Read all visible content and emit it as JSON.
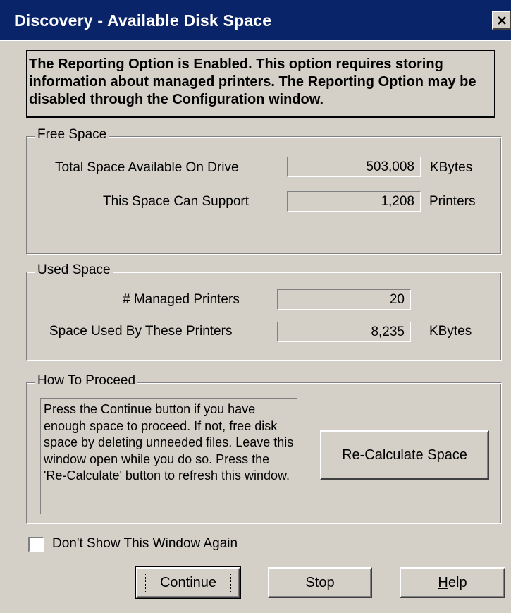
{
  "window": {
    "title": "Discovery - Available Disk Space"
  },
  "notice": {
    "text": "The Reporting Option is Enabled. This option requires storing information about managed printers. The Reporting Option may be disabled through the Configuration window."
  },
  "free_space": {
    "legend": "Free Space",
    "total_label": "Total Space Available On Drive",
    "total_value": "503,008",
    "total_unit": "KBytes",
    "support_label": "This Space Can Support",
    "support_value": "1,208",
    "support_unit": "Printers"
  },
  "used_space": {
    "legend": "Used Space",
    "managed_label": "# Managed Printers",
    "managed_value": "20",
    "used_label": "Space Used By These Printers",
    "used_value": "8,235",
    "used_unit": "KBytes"
  },
  "how_to_proceed": {
    "legend": "How To Proceed",
    "instructions": "Press the Continue button if you have enough space to proceed. If not, free disk space by deleting unneeded files. Leave this window open while you do so. Press the 'Re-Calculate' button to refresh  this window.",
    "recalculate_label": "Re-Calculate Space"
  },
  "dont_show": {
    "label": "Don't Show This Window Again",
    "checked": false
  },
  "buttons": {
    "continue_label": "Continue",
    "stop_label": "Stop",
    "help_label": "Help"
  },
  "icons": {
    "close": "close-icon"
  }
}
